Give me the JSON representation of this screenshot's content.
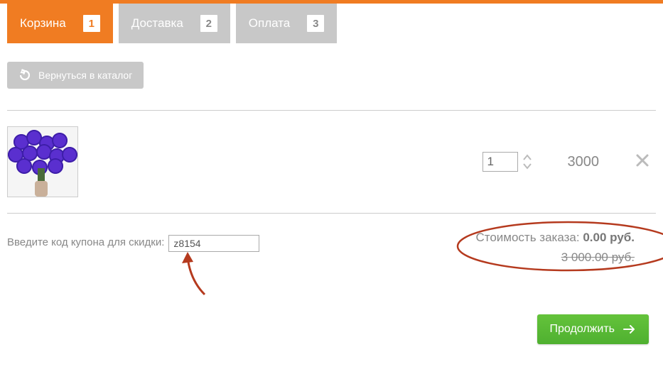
{
  "tabs": [
    {
      "label": "Корзина",
      "num": "1",
      "active": true
    },
    {
      "label": "Доставка",
      "num": "2",
      "active": false
    },
    {
      "label": "Оплата",
      "num": "3",
      "active": false
    }
  ],
  "back_button": "Вернуться в каталог",
  "cart": {
    "qty": "1",
    "price": "3000"
  },
  "coupon": {
    "label": "Введите код купона для скидки:",
    "value": "z8154"
  },
  "totals": {
    "label": "Стоимость заказа:",
    "amount": "0.00 руб.",
    "old": "3 000.00 руб."
  },
  "continue_label": "Продолжить",
  "colors": {
    "accent": "#f07c22",
    "success": "#55b030",
    "annotation": "#b53a1e"
  }
}
